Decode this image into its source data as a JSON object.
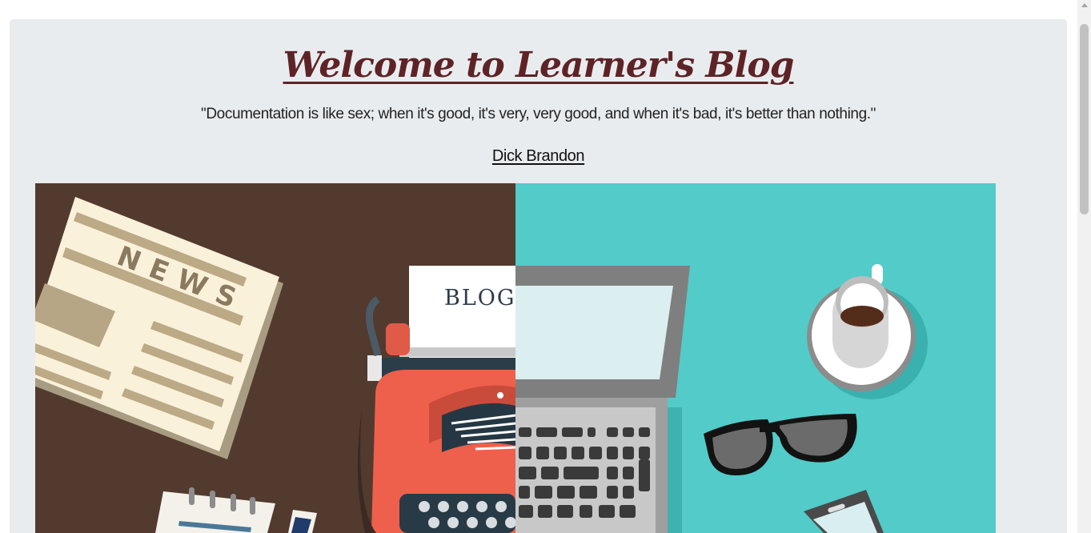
{
  "header": {
    "title": "Welcome to Learner's Blog",
    "quote": "\"Documentation is like sex; when it's good, it's very, very good, and when it's bad, it's better than nothing.\"",
    "author": "Dick Brandon"
  },
  "hero": {
    "alt": "Flat illustration of a desk with newspaper, typewriter, laptop, coffee cup and glasses",
    "newspaper_text": "NEWS",
    "paper_text": "BLOG",
    "colors": {
      "left_bg": "#533a2e",
      "right_bg": "#52cbc9",
      "typewriter": "#ef604c",
      "title_color": "#5e2326",
      "card_bg": "#e9ecef"
    }
  }
}
